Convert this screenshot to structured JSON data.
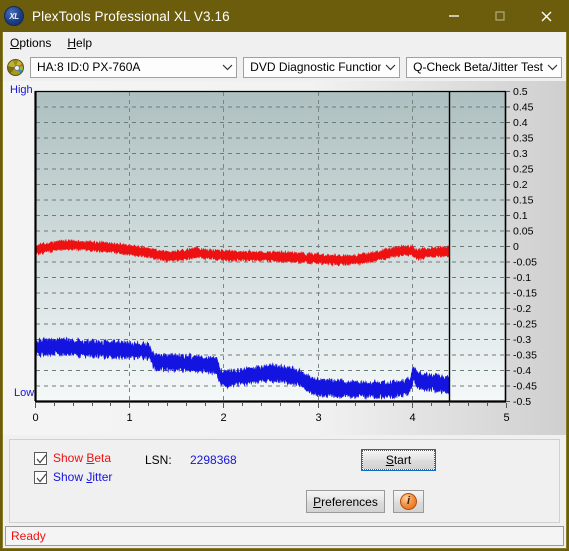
{
  "window": {
    "title": "PlexTools Professional XL V3.16",
    "app_icon": "xl-disc-icon",
    "minimize_label": "minimize-icon",
    "maximize_label": "maximize-icon",
    "close_label": "close-icon",
    "titlebar_color": "#6b5d0c"
  },
  "menubar": {
    "items": [
      {
        "label": "Options",
        "mnemonic": "O"
      },
      {
        "label": "Help",
        "mnemonic": "H"
      }
    ]
  },
  "toolbar": {
    "disc_icon": "cd-disc-icon",
    "drive_select": {
      "value": "HA:8 ID:0  PX-760A",
      "options": [
        "HA:8 ID:0  PX-760A"
      ]
    },
    "function_select": {
      "value": "DVD Diagnostic Functions",
      "options": [
        "DVD Diagnostic Functions"
      ]
    },
    "test_select": {
      "value": "Q-Check Beta/Jitter Test",
      "options": [
        "Q-Check Beta/Jitter Test"
      ]
    }
  },
  "chart_labels": {
    "high": "High",
    "low": "Low"
  },
  "controls": {
    "show_beta": {
      "label": "Show Beta",
      "mnemonic": "B",
      "checked": true,
      "color": "#ee1111"
    },
    "show_jitter": {
      "label": "Show Jitter",
      "mnemonic": "J",
      "checked": true,
      "color": "#1414e0"
    },
    "lsn_label": "LSN:",
    "lsn_value": "2298368",
    "start_button": {
      "label": "Start",
      "mnemonic": "S",
      "focused": true
    },
    "preferences_button": {
      "label": "Preferences",
      "mnemonic": "P"
    },
    "info_button": {
      "label": "i",
      "name": "info-icon"
    }
  },
  "statusbar": {
    "text": "Ready",
    "color": "#ee1111"
  },
  "chart_data": {
    "type": "line",
    "title": "Q-Check Beta/Jitter Test",
    "xlabel": "",
    "ylabel": "",
    "xlim": [
      0,
      5
    ],
    "ylim": [
      -0.5,
      0.5
    ],
    "xticks": [
      0,
      1,
      2,
      3,
      4,
      5
    ],
    "yticks": [
      0.5,
      0.45,
      0.4,
      0.35,
      0.3,
      0.25,
      0.2,
      0.15,
      0.1,
      0.05,
      0,
      -0.05,
      -0.1,
      -0.15,
      -0.2,
      -0.25,
      -0.3,
      -0.35,
      -0.4,
      -0.45,
      -0.5
    ],
    "ytick_labels": [
      "0.5",
      "0.45",
      "0.4",
      "0.35",
      "0.3",
      "0.25",
      "0.2",
      "0.15",
      "0.1",
      "0.05",
      "0",
      "-0.05",
      "-0.1",
      "-0.15",
      "-0.2",
      "-0.25",
      "-0.3",
      "-0.35",
      "-0.4",
      "-0.45",
      "-0.5"
    ],
    "grid": true,
    "grid_style": "dashed",
    "data_end_x": 4.4,
    "axis_side_labels": {
      "top_left": "High",
      "bottom_left": "Low"
    },
    "plot_bg_gradient": [
      "#adbfc0",
      "#f4f8f8"
    ],
    "series": [
      {
        "name": "Beta",
        "color": "#ee1111",
        "noise": 0.018,
        "x": [
          0.0,
          0.12,
          0.25,
          0.38,
          0.5,
          0.62,
          0.75,
          0.88,
          1.0,
          1.1,
          1.2,
          1.3,
          1.42,
          1.55,
          1.65,
          1.72,
          1.8,
          1.95,
          2.1,
          2.25,
          2.4,
          2.55,
          2.7,
          2.85,
          3.0,
          3.15,
          3.3,
          3.45,
          3.6,
          3.72,
          3.8,
          3.9,
          4.0,
          4.05,
          4.12,
          4.2,
          4.3,
          4.4
        ],
        "values": [
          -0.012,
          -0.006,
          0.002,
          0.004,
          0.002,
          -0.001,
          -0.004,
          -0.008,
          -0.013,
          -0.017,
          -0.021,
          -0.028,
          -0.034,
          -0.03,
          -0.026,
          -0.02,
          -0.026,
          -0.029,
          -0.031,
          -0.032,
          -0.033,
          -0.034,
          -0.036,
          -0.038,
          -0.041,
          -0.044,
          -0.046,
          -0.042,
          -0.034,
          -0.026,
          -0.02,
          -0.016,
          -0.015,
          -0.028,
          -0.024,
          -0.021,
          -0.019,
          -0.018
        ]
      },
      {
        "name": "Jitter",
        "color": "#1414e0",
        "noise": 0.03,
        "x": [
          0.0,
          0.1,
          0.22,
          0.35,
          0.48,
          0.6,
          0.72,
          0.85,
          0.98,
          1.08,
          1.16,
          1.22,
          1.26,
          1.32,
          1.45,
          1.58,
          1.7,
          1.8,
          1.88,
          1.93,
          1.97,
          2.02,
          2.1,
          2.22,
          2.35,
          2.48,
          2.6,
          2.72,
          2.8,
          2.88,
          2.95,
          3.02,
          3.12,
          3.25,
          3.4,
          3.55,
          3.68,
          3.8,
          3.92,
          3.98,
          4.02,
          4.06,
          4.1,
          4.16,
          4.24,
          4.32,
          4.4
        ],
        "values": [
          -0.33,
          -0.326,
          -0.324,
          -0.326,
          -0.33,
          -0.332,
          -0.333,
          -0.334,
          -0.336,
          -0.338,
          -0.34,
          -0.341,
          -0.372,
          -0.374,
          -0.376,
          -0.378,
          -0.38,
          -0.382,
          -0.384,
          -0.386,
          -0.424,
          -0.428,
          -0.426,
          -0.42,
          -0.414,
          -0.41,
          -0.412,
          -0.418,
          -0.424,
          -0.44,
          -0.452,
          -0.456,
          -0.458,
          -0.46,
          -0.462,
          -0.463,
          -0.464,
          -0.462,
          -0.458,
          -0.448,
          -0.412,
          -0.43,
          -0.436,
          -0.438,
          -0.442,
          -0.446,
          -0.448
        ]
      }
    ]
  }
}
